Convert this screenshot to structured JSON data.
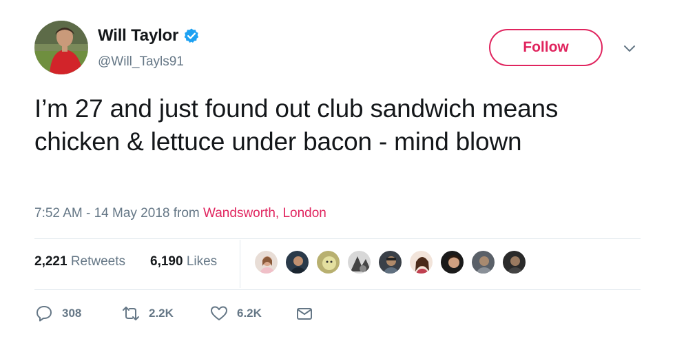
{
  "user": {
    "display_name": "Will Taylor",
    "handle": "@Will_Tayls91",
    "verified": true,
    "avatar_icon": "user-avatar"
  },
  "follow_label": "Follow",
  "tweet": {
    "text": "I’m 27 and just found out club sandwich means chicken & lettuce under bacon - mind blown"
  },
  "meta": {
    "timestamp": "7:52 AM - 14 May 2018 from ",
    "location": "Wandsworth, London"
  },
  "stats": {
    "retweets_count": "2,221",
    "retweets_label": "Retweets",
    "likes_count": "6,190",
    "likes_label": "Likes",
    "likers_shown": 9
  },
  "actions": {
    "replies": "308",
    "retweets": "2.2K",
    "likes": "6.2K"
  },
  "colors": {
    "accent": "#e0245e",
    "verified": "#1da1f2",
    "muted_text": "#657786",
    "text": "#14171a",
    "divider": "#e1e8ed"
  }
}
